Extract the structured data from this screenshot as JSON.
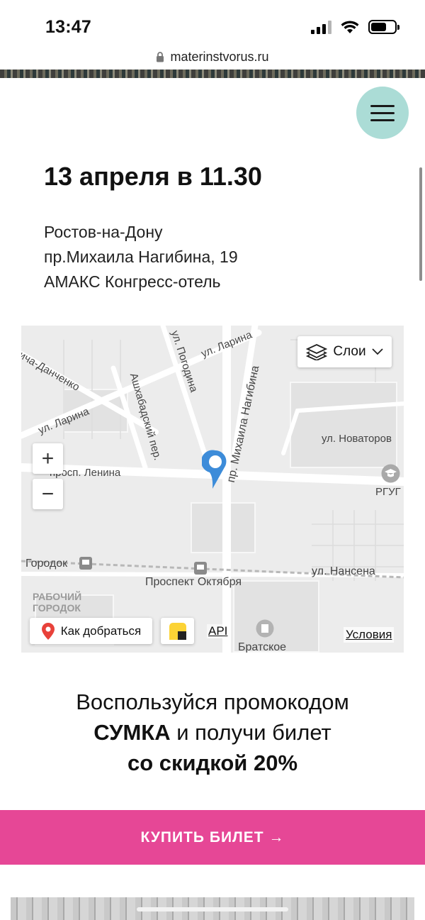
{
  "status_bar": {
    "time": "13:47",
    "battery_level": 0.65
  },
  "browser": {
    "url": "materinstvorus.ru"
  },
  "event": {
    "date_time": "13 апреля в 11.30",
    "address_lines": [
      "Ростов-на-Дону",
      "пр.Михаила Нагибина, 19",
      "АМАКС Конгресс-отель"
    ]
  },
  "map": {
    "layers_label": "Слои",
    "zoom_in": "+",
    "zoom_out": "−",
    "route_label": "Как добраться",
    "api_label": "API",
    "terms_label": "Условия",
    "marker_color": "#3d8cd9",
    "labels": {
      "danchenko": "ича-Данченко",
      "pogodina": "ул. Погодина",
      "larina_top": "ул. Ларина",
      "nagibina": "пр. Михаила Нагибина",
      "ashkhabadsky": "Ашхабадский пер.",
      "larina_left": "ул. Ларина",
      "novatorov": "ул. Новаторов",
      "lenina": "просп. Ленина",
      "rgug": "РГУГ",
      "gorodok": "Городок",
      "nansena": "ул. Нансена",
      "prospekt_oktyabrya": "Проспект Октября",
      "rabochiy": "РАБОЧИЙ",
      "gorodok_district": "ГОРОДОК",
      "bratskoe": "Братское"
    }
  },
  "promo": {
    "line1": "Воспользуйся промокодом",
    "code": "СУМКА",
    "line2_rest": " и получи билет",
    "line3": "со скидкой 20%"
  },
  "cta": {
    "buy_label": "КУПИТЬ БИЛЕТ →",
    "color": "#e64796"
  },
  "colors": {
    "menu_bg": "#abdcd6"
  }
}
